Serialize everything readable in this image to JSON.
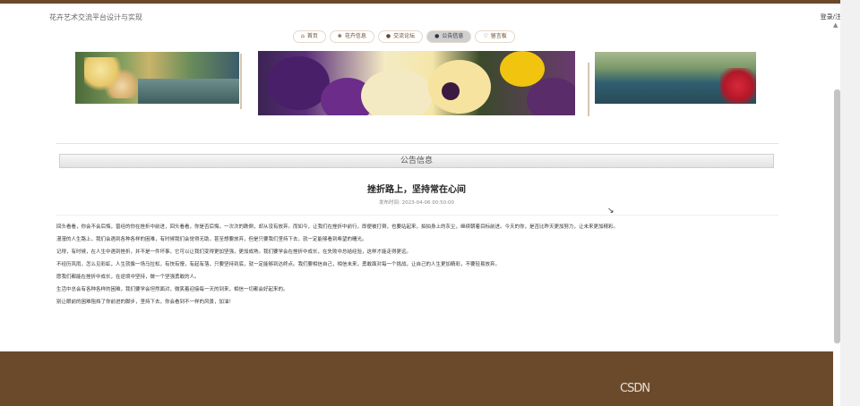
{
  "header": {
    "site_title": "花卉艺术交流平台设计与实现",
    "login_link": "登录/注册"
  },
  "nav": [
    {
      "label": "首页",
      "icon": "home-icon"
    },
    {
      "label": "花卉信息",
      "icon": "flower-icon"
    },
    {
      "label": "交流论坛",
      "icon": "forum-icon"
    },
    {
      "label": "公告信息",
      "icon": "notice-icon",
      "active": true
    },
    {
      "label": "留言板",
      "icon": "message-icon"
    }
  ],
  "section": {
    "title": "公告信息"
  },
  "post": {
    "title": "挫折路上，坚持常在心间",
    "meta": "发布时间: 2023-04-06 00:50:00",
    "paragraphs": [
      "回头看看，你会不会后悔，曾经的你在挫折中前进，回头看看，你是否后悔，一次次的跌倒，却从没有放弃。而如今，让我们在挫折中前行，即便被打倒，也要站起来，拍拍身上的灰尘，继续朝着目标前进。今天的你，是否比昨天更加努力，让未来更加精彩。",
      "漫漫的人生路上，我们会遇到各种各样的困难，有时候我们会觉得无助，甚至想要放弃，但是只要我们坚持下去，就一定能够看到希望的曙光。",
      "记得，有时候，在人生中遇到挫折，并不是一件坏事，它可以让我们变得更加坚强，更加成熟。我们要学会在挫折中成长，在失败中总结经验，这样才能走得更远。",
      "不经历风雨，怎么见彩虹，人生就像一场马拉松，有快有慢，有起有落，只要坚持到底，就一定能够到达终点。我们要相信自己，相信未来，勇敢面对每一个挑战，让自己的人生更加精彩，不要轻易放弃。",
      "愿我们都能在挫折中成长，在逆境中坚持，做一个坚强勇敢的人。",
      "生活中总会有各种各样的困难，我们要学会坦然面对，微笑着迎接每一天的到来，相信一切都会好起来的。",
      "别让眼前的困难阻挡了你前进的脚步，坚持下去，你会看到不一样的风景，加油！"
    ]
  },
  "footer": {
    "logo_text": "CSDN"
  }
}
